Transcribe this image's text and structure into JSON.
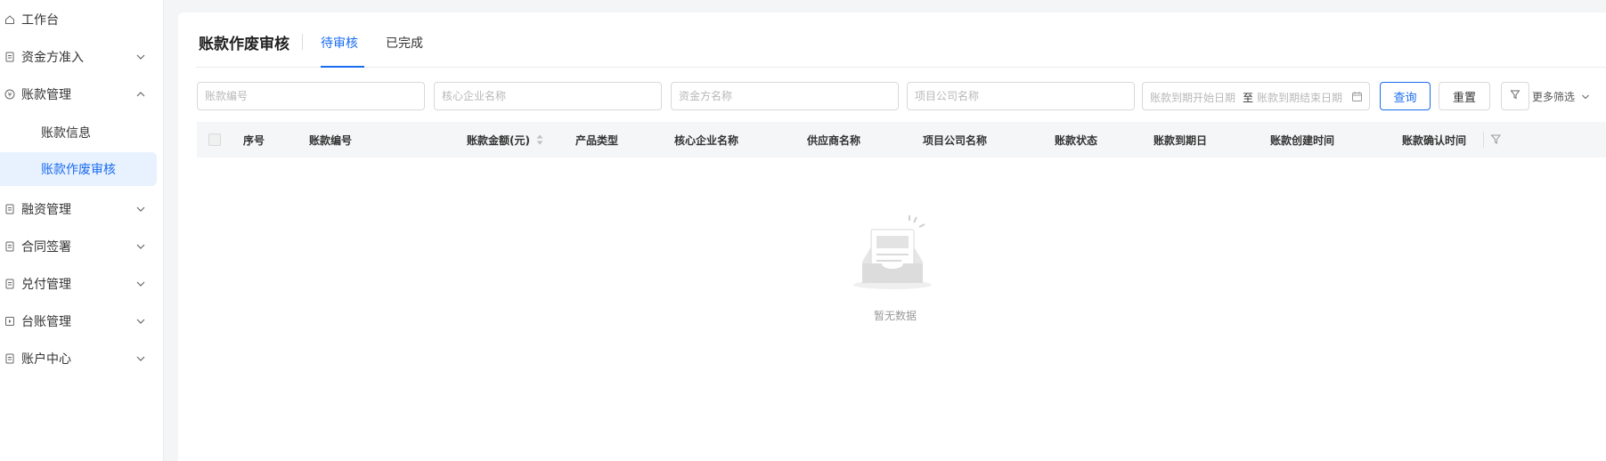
{
  "sidebar": {
    "items": [
      {
        "label": "工作台",
        "icon": "home-icon",
        "expandable": false
      },
      {
        "label": "资金方准入",
        "icon": "document-icon",
        "expandable": true
      },
      {
        "label": "账款管理",
        "icon": "money-icon",
        "expandable": true,
        "expanded": true,
        "children": [
          {
            "label": "账款信息",
            "active": false
          },
          {
            "label": "账款作废审核",
            "active": true
          }
        ]
      },
      {
        "label": "融资管理",
        "icon": "document-icon",
        "expandable": true
      },
      {
        "label": "合同签署",
        "icon": "document-icon",
        "expandable": true
      },
      {
        "label": "兑付管理",
        "icon": "document-icon",
        "expandable": true
      },
      {
        "label": "台账管理",
        "icon": "ledger-icon",
        "expandable": true
      },
      {
        "label": "账户中心",
        "icon": "document-icon",
        "expandable": true
      }
    ]
  },
  "header": {
    "title": "账款作废审核",
    "tabs": [
      {
        "label": "待审核",
        "active": true
      },
      {
        "label": "已完成",
        "active": false
      }
    ]
  },
  "filters": {
    "bill_no_placeholder": "账款编号",
    "core_company_placeholder": "核心企业名称",
    "funder_placeholder": "资金方名称",
    "project_company_placeholder": "项目公司名称",
    "due_start_placeholder": "账款到期开始日期",
    "range_separator": "至",
    "due_end_placeholder": "账款到期结束日期",
    "search_label": "查询",
    "reset_label": "重置",
    "more_filters_label": "更多筛选"
  },
  "table": {
    "columns": [
      "序号",
      "账款编号",
      "账款金额(元)",
      "产品类型",
      "核心企业名称",
      "供应商名称",
      "项目公司名称",
      "账款状态",
      "账款到期日",
      "账款创建时间",
      "账款确认时间"
    ],
    "rows": [],
    "empty_text": "暂无数据"
  },
  "colors": {
    "accent": "#1a6cf0",
    "active_bg": "#e8f1fe",
    "header_bg": "#f5f6f8"
  }
}
